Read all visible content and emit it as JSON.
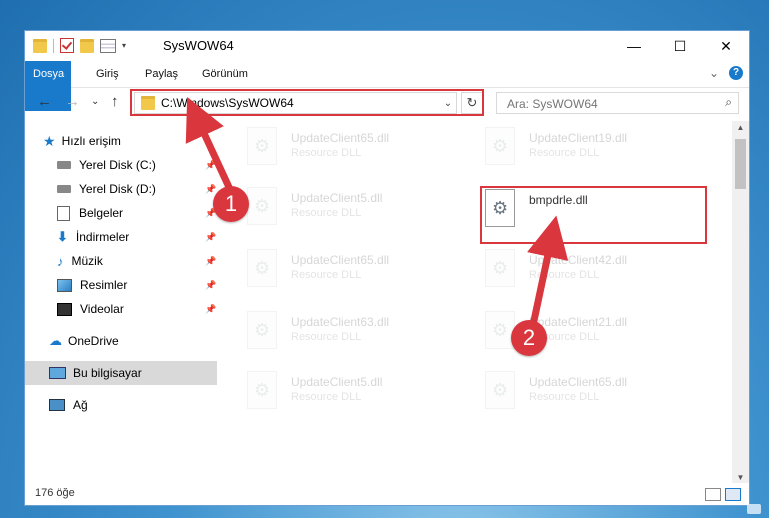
{
  "window": {
    "title": "SysWOW64",
    "minimize_glyph": "—",
    "maximize_glyph": "☐",
    "close_glyph": "✕"
  },
  "ribbon": {
    "tabs": [
      "Dosya",
      "Giriş",
      "Paylaş",
      "Görünüm"
    ],
    "expand_glyph": "⌄",
    "help_glyph": "?"
  },
  "nav": {
    "back_glyph": "←",
    "forward_glyph": "→",
    "recent_glyph": "⌄",
    "up_glyph": "↑",
    "address": "C:\\Windows\\SysWOW64",
    "address_dropdown_glyph": "⌄",
    "refresh_glyph": "↻",
    "search_placeholder": "Ara: SysWOW64",
    "search_glyph": "⌕"
  },
  "sidebar": {
    "items": [
      {
        "label": "Hızlı erişim"
      },
      {
        "label": "Yerel Disk (C:)"
      },
      {
        "label": "Yerel Disk (D:)"
      },
      {
        "label": "Belgeler"
      },
      {
        "label": "İndirmeler"
      },
      {
        "label": "Müzik"
      },
      {
        "label": "Resimler"
      },
      {
        "label": "Videolar"
      },
      {
        "label": "OneDrive"
      },
      {
        "label": "Bu bilgisayar"
      },
      {
        "label": "Ağ"
      }
    ],
    "pin_glyph": "📌"
  },
  "files": [
    {
      "name": "UpdateClient65.dll",
      "type": "Resource DLL"
    },
    {
      "name": "UpdateClient19.dll",
      "type": "Resource DLL"
    },
    {
      "name": "UpdateClient5.dll",
      "type": "Resource DLL"
    },
    {
      "name": "bmpdrle.dll",
      "type": ""
    },
    {
      "name": "UpdateClient65.dll",
      "type": "Resource DLL"
    },
    {
      "name": "UpdateClient42.dll",
      "type": "Resource DLL"
    },
    {
      "name": "UpdateClient63.dll",
      "type": "Resource DLL"
    },
    {
      "name": "UpdateClient21.dll",
      "type": "Resource DLL"
    },
    {
      "name": "UpdateClient5.dll",
      "type": "Resource DLL"
    },
    {
      "name": "UpdateClient65.dll",
      "type": "Resource DLL"
    }
  ],
  "status": {
    "item_count": "176 öğe"
  },
  "callouts": {
    "step1": "1",
    "step2": "2"
  },
  "colors": {
    "accent": "#1979ca",
    "highlight": "#d9363e"
  }
}
